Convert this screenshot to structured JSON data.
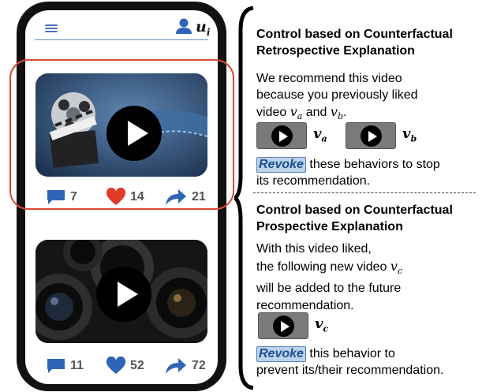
{
  "phone": {
    "user_label": "u",
    "user_sub": "i",
    "posts": [
      {
        "comments": "7",
        "likes": "14",
        "shares": "21",
        "like_color": "#e03b2a"
      },
      {
        "comments": "11",
        "likes": "52",
        "shares": "72",
        "like_color": "#2f64b7"
      }
    ]
  },
  "retrospective": {
    "title_line1": "Control based on Counterfactual",
    "title_line2": "Retrospective Explanation",
    "text_line1": "We recommend this video",
    "text_line2": "because you previously liked",
    "text_line3_prefix": "video ",
    "var_a": "v",
    "var_a_sub": "a",
    "and": " and ",
    "var_b": "v",
    "var_b_sub": "b",
    "period": ".",
    "revoke": "Revoke",
    "revoke_rest": " these behaviors to stop",
    "revoke_line2": "its recommendation."
  },
  "prospective": {
    "title_line1": "Control based on Counterfactual",
    "title_line2": "Prospective Explanation",
    "text_line1": "With this video liked,",
    "text_line2_prefix": "the following new video ",
    "var_c": "v",
    "var_c_sub": "c",
    "text_line3": "will be added to the future",
    "text_line4": "recommendation.",
    "revoke": "Revoke",
    "revoke_rest": " this behavior to",
    "revoke_line2": "prevent its/their recommendation."
  },
  "colors": {
    "accent": "#2f64b7",
    "highlight": "#dc4a35"
  }
}
